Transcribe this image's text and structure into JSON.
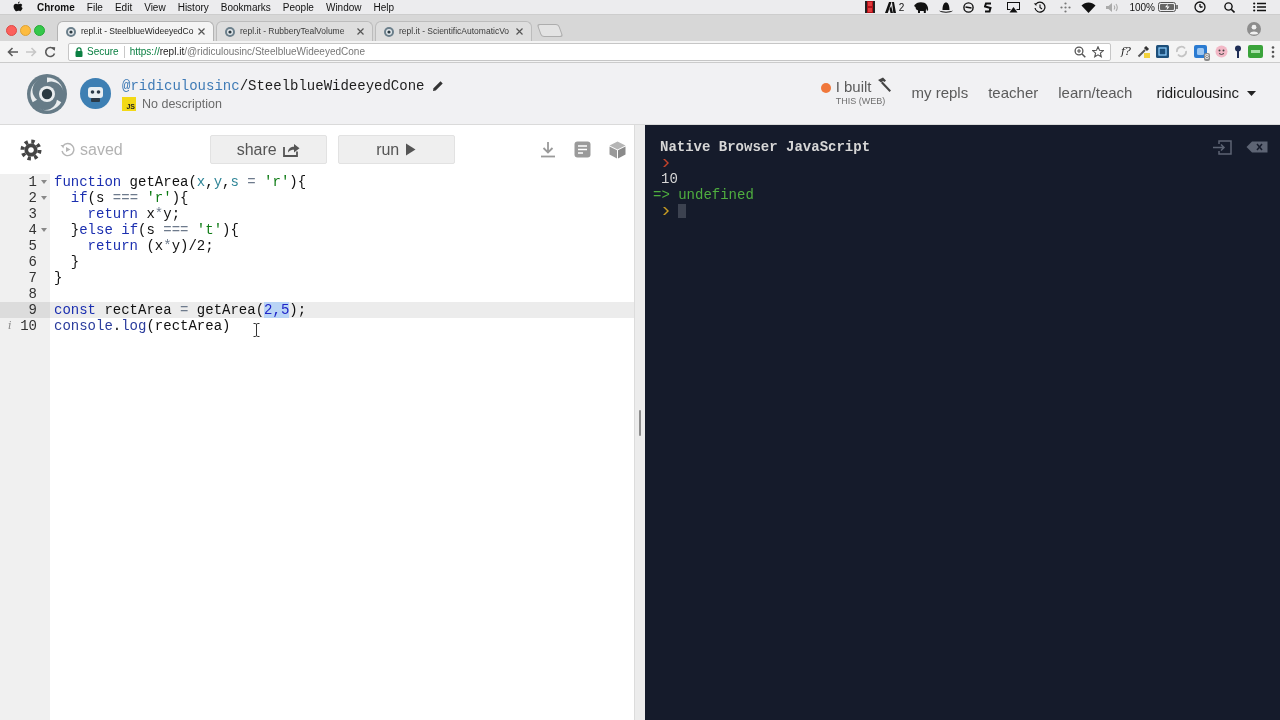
{
  "menu_bar": {
    "app_name": "Chrome",
    "menus": [
      "File",
      "Edit",
      "View",
      "History",
      "Bookmarks",
      "People",
      "Window",
      "Help"
    ],
    "status_count": "2",
    "battery": "100%"
  },
  "browser": {
    "tabs": [
      {
        "title": "repl.it - SteelblueWideeyedCo",
        "selected": true
      },
      {
        "title": "repl.it - RubberyTealVolume",
        "selected": false
      },
      {
        "title": "repl.it - ScientificAutomaticVo",
        "selected": false
      }
    ],
    "nav_buttons": [
      {
        "kind": "back",
        "disabled": false
      },
      {
        "kind": "forward",
        "disabled": true
      },
      {
        "kind": "reload",
        "disabled": false
      }
    ],
    "address_bar": {
      "security": "Secure",
      "url": [
        {
          "kind": "scheme",
          "text": "https://"
        },
        {
          "kind": "host",
          "text": "repl.it"
        },
        {
          "kind": "path",
          "text": "/@ridiculousinc/SteelblueWideeyedCone"
        }
      ]
    },
    "extension_label": "f?",
    "extension_badge": "8"
  },
  "repl_header": {
    "owner": "@ridiculousinc",
    "repl_name": "/SteelblueWideeyedCone",
    "language_badge": "JS",
    "description": "No description",
    "nav": [
      {
        "kind": "promo",
        "text": "I built",
        "subtext": "THIS (WEB)"
      },
      {
        "kind": "link",
        "text": "my repls"
      },
      {
        "kind": "link",
        "text": "teacher"
      },
      {
        "kind": "link",
        "text": "learn/teach"
      },
      {
        "kind": "account",
        "text": "ridiculousinc"
      }
    ]
  },
  "editor": {
    "status": "saved",
    "buttons": [
      {
        "kind": "share",
        "label": "share"
      },
      {
        "kind": "run",
        "label": "run"
      }
    ],
    "lines": [
      {
        "number": "1",
        "foldable": true,
        "active": false,
        "tokens": [
          {
            "kind": "keyword",
            "text": "function"
          },
          {
            "kind": "plain",
            "text": " getArea("
          },
          {
            "kind": "param",
            "text": "x"
          },
          {
            "kind": "plain",
            "text": ","
          },
          {
            "kind": "param",
            "text": "y"
          },
          {
            "kind": "plain",
            "text": ","
          },
          {
            "kind": "param",
            "text": "s"
          },
          {
            "kind": "operator",
            "text": " = "
          },
          {
            "kind": "string",
            "text": "'r'"
          },
          {
            "kind": "plain",
            "text": "){"
          }
        ]
      },
      {
        "number": "2",
        "foldable": true,
        "active": false,
        "tokens": [
          {
            "kind": "keyword",
            "text": "  if"
          },
          {
            "kind": "plain",
            "text": "(s"
          },
          {
            "kind": "operator",
            "text": " === "
          },
          {
            "kind": "string",
            "text": "'r'"
          },
          {
            "kind": "plain",
            "text": "){"
          }
        ]
      },
      {
        "number": "3",
        "foldable": false,
        "active": false,
        "tokens": [
          {
            "kind": "keyword",
            "text": "    return"
          },
          {
            "kind": "plain",
            "text": " x"
          },
          {
            "kind": "operator",
            "text": "*"
          },
          {
            "kind": "plain",
            "text": "y;"
          }
        ]
      },
      {
        "number": "4",
        "foldable": true,
        "active": false,
        "tokens": [
          {
            "kind": "plain",
            "text": "  }"
          },
          {
            "kind": "keyword",
            "text": "else if"
          },
          {
            "kind": "plain",
            "text": "(s"
          },
          {
            "kind": "operator",
            "text": " === "
          },
          {
            "kind": "string",
            "text": "'t'"
          },
          {
            "kind": "plain",
            "text": "){"
          }
        ]
      },
      {
        "number": "5",
        "foldable": false,
        "active": false,
        "tokens": [
          {
            "kind": "keyword",
            "text": "    return"
          },
          {
            "kind": "plain",
            "text": " (x"
          },
          {
            "kind": "operator",
            "text": "*"
          },
          {
            "kind": "plain",
            "text": "y)/2;"
          }
        ]
      },
      {
        "number": "6",
        "foldable": false,
        "active": false,
        "tokens": [
          {
            "kind": "plain",
            "text": "  }"
          }
        ]
      },
      {
        "number": "7",
        "foldable": false,
        "active": false,
        "tokens": [
          {
            "kind": "plain",
            "text": "}"
          }
        ]
      },
      {
        "number": "8",
        "foldable": false,
        "active": false
      },
      {
        "number": "9",
        "foldable": false,
        "active": true,
        "tokens": [
          {
            "kind": "keyword",
            "text": "const"
          },
          {
            "kind": "plain",
            "text": " rectArea"
          },
          {
            "kind": "operator",
            "text": " = "
          },
          {
            "kind": "plain",
            "text": "getArea("
          },
          {
            "kind": "selection",
            "text": "2,5"
          },
          {
            "kind": "plain",
            "text": ");"
          }
        ]
      },
      {
        "number": "10",
        "foldable": false,
        "active": false,
        "annotation": "i",
        "tokens": [
          {
            "kind": "builtin",
            "text": "console"
          },
          {
            "kind": "plain",
            "text": "."
          },
          {
            "kind": "builtin",
            "text": "log"
          },
          {
            "kind": "plain",
            "text": "(rectArea)"
          }
        ]
      }
    ]
  },
  "console": {
    "title": "Native Browser JavaScript",
    "entries": [
      {
        "kind": "input"
      },
      {
        "kind": "output",
        "text": "10"
      },
      {
        "kind": "result",
        "text": "=> undefined"
      },
      {
        "kind": "prompt"
      }
    ]
  }
}
